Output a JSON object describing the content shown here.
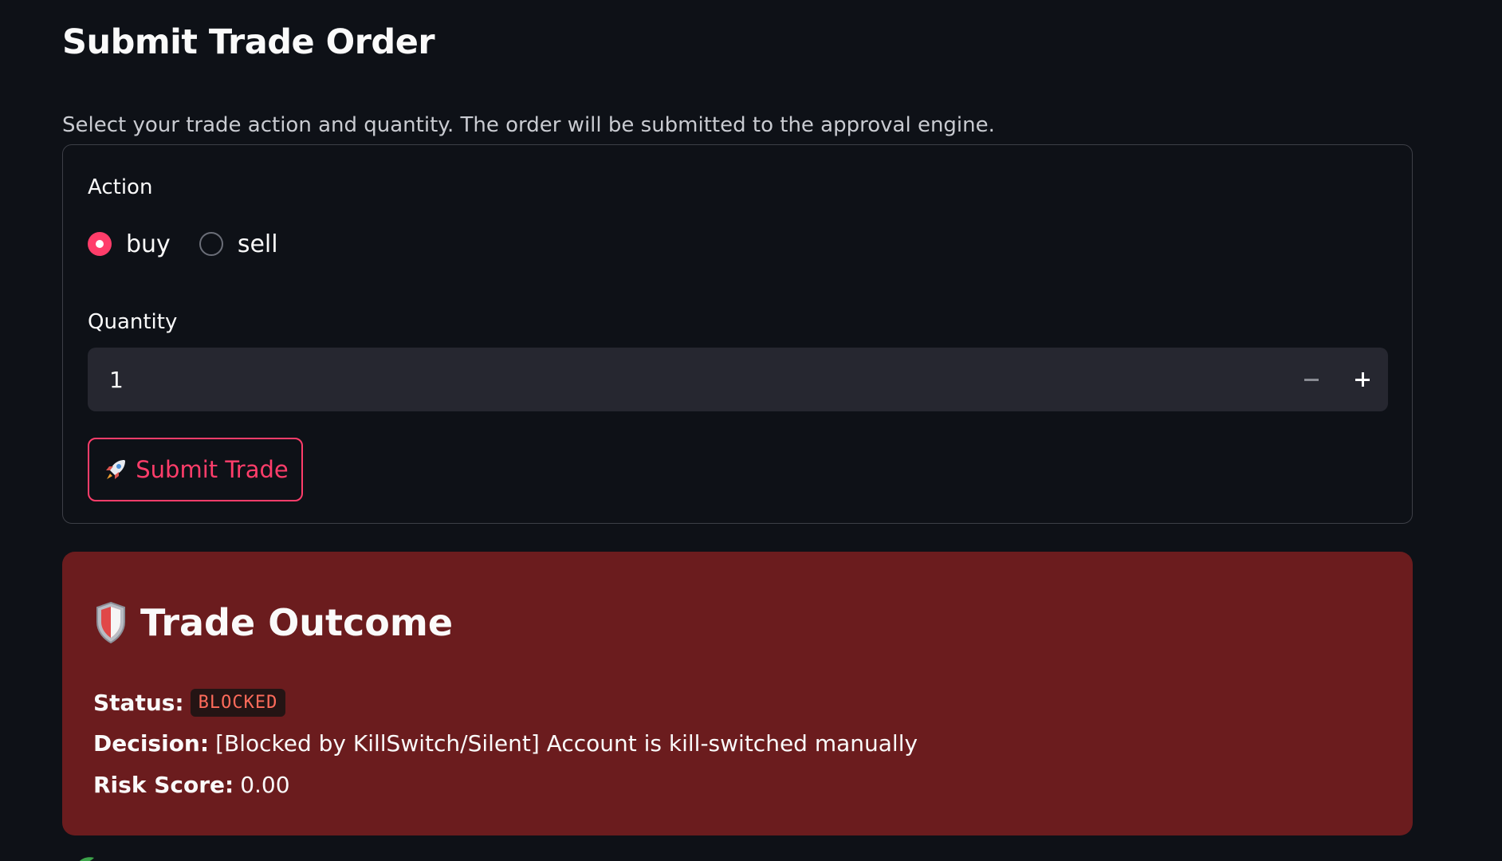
{
  "page": {
    "title": "Submit Trade Order",
    "subtitle": "Select your trade action and quantity. The order will be submitted to the approval engine."
  },
  "form": {
    "action_label": "Action",
    "action_options": [
      {
        "label": "buy",
        "selected": true
      },
      {
        "label": "sell",
        "selected": false
      }
    ],
    "quantity_label": "Quantity",
    "quantity_value": "1",
    "submit_label": "Submit Trade",
    "submit_icon": "rocket-icon"
  },
  "outcome": {
    "icon": "shield-icon",
    "title": "Trade Outcome",
    "status_label": "Status:",
    "status_value": "BLOCKED",
    "decision_label": "Decision:",
    "decision_value": "[Blocked by KillSwitch/Silent] Account is kill-switched manually",
    "risk_label": "Risk Score:",
    "risk_value": "0.00"
  },
  "colors": {
    "accent": "#ff3d6a",
    "background": "#0e1117",
    "outcome_background": "#6b1c1e",
    "input_background": "#262730",
    "badge_text": "#ff6b5b"
  }
}
